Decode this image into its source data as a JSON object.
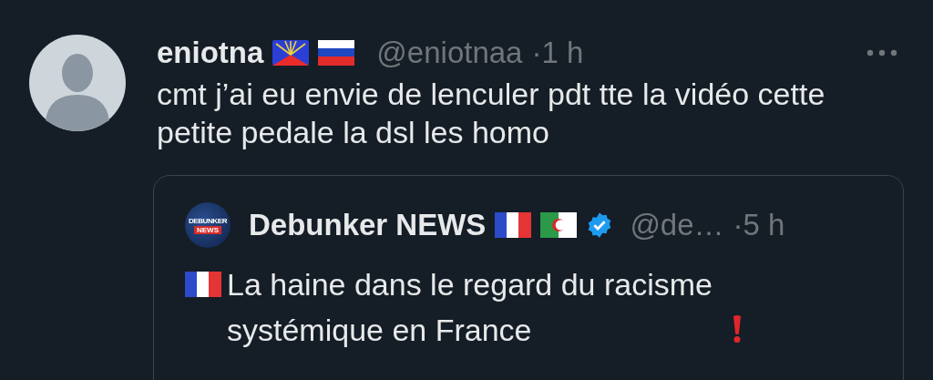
{
  "tweet": {
    "display_name": "eniotna",
    "flags": [
      {
        "kind": "reunion"
      },
      {
        "kind": "russia"
      }
    ],
    "handle": "@eniotnaa",
    "time": "·1 h",
    "text": "cmt j’ai eu envie de lenculer pdt tte la vidéo cette petite pedale la dsl les homo",
    "quote": {
      "logo": {
        "line_1": "DEBUNKER",
        "line_2": "NEWS"
      },
      "display_name": "Debunker NEWS",
      "flags": [
        {
          "kind": "france"
        },
        {
          "kind": "algeria"
        }
      ],
      "verified": true,
      "handle": "@de…",
      "time": "·5 h",
      "text": "La haine dans le regard du racisme systémique en France"
    }
  }
}
